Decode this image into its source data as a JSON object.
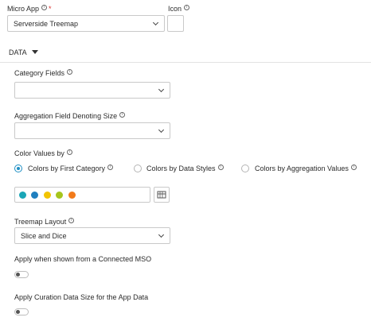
{
  "micro_app": {
    "label": "Micro App",
    "required_mark": "*",
    "value": "Serverside Treemap"
  },
  "icon_field": {
    "label": "Icon"
  },
  "section": {
    "label": "DATA"
  },
  "category_fields": {
    "label": "Category Fields",
    "value": ""
  },
  "aggregation_field": {
    "label": "Aggregation Field Denoting Size",
    "value": ""
  },
  "color_values": {
    "label": "Color Values by",
    "options": [
      {
        "label": "Colors by First Category",
        "selected": true
      },
      {
        "label": "Colors by Data Styles",
        "selected": false
      },
      {
        "label": "Colors by Aggregation Values",
        "selected": false
      }
    ]
  },
  "palette": {
    "colors": [
      "#1aa6b7",
      "#1f7fbf",
      "#f2c400",
      "#a6c51d",
      "#f27a1a"
    ]
  },
  "treemap_layout": {
    "label": "Treemap Layout",
    "value": "Slice and Dice"
  },
  "connected_mso": {
    "label": "Apply when shown from a Connected MSO",
    "on": false
  },
  "curation_size": {
    "label": "Apply Curation Data Size for the App Data",
    "on": false
  },
  "info_glyph": "i"
}
